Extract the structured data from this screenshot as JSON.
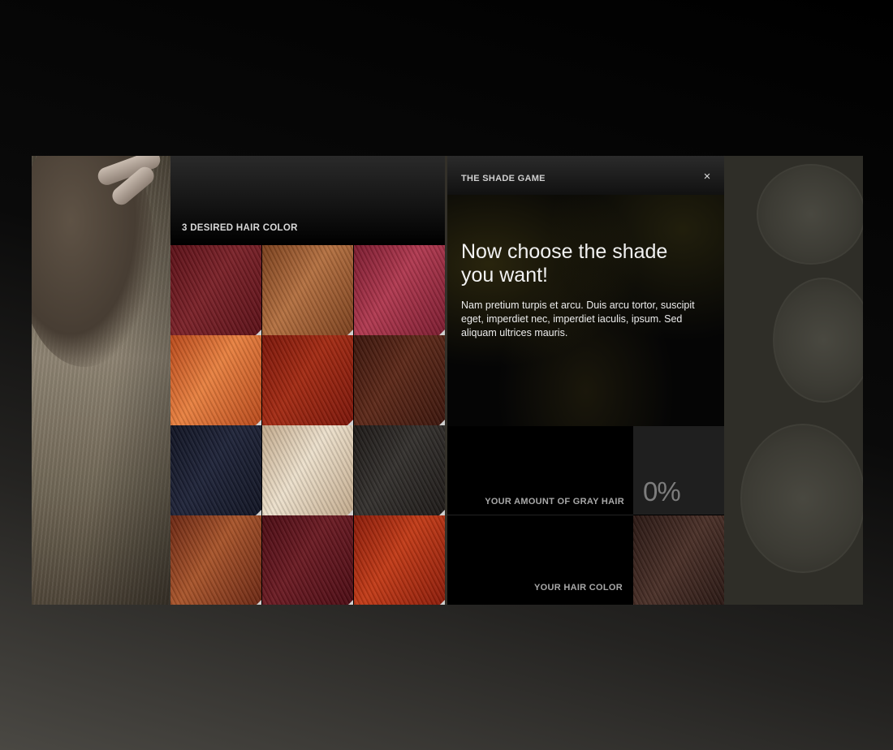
{
  "left_panel": {
    "title": "3 DESIRED HAIR COLOR",
    "swatches": [
      {
        "name": "burgundy",
        "color": "#5a0f16",
        "highlight": "#7a2128"
      },
      {
        "name": "copper-brown",
        "color": "#7a3f1c",
        "highlight": "#b47040"
      },
      {
        "name": "raspberry",
        "color": "#7a1a2e",
        "highlight": "#b0384f"
      },
      {
        "name": "bright-copper",
        "color": "#b8481a",
        "highlight": "#e8803f"
      },
      {
        "name": "red",
        "color": "#7a1408",
        "highlight": "#a32a12"
      },
      {
        "name": "dark-auburn",
        "color": "#3a140b",
        "highlight": "#5c2818"
      },
      {
        "name": "blue-black",
        "color": "#101322",
        "highlight": "#1e2338"
      },
      {
        "name": "light-blonde",
        "color": "#c2a98b",
        "highlight": "#ece0cc"
      },
      {
        "name": "soft-black",
        "color": "#1c1816",
        "highlight": "#33302d"
      },
      {
        "name": "auburn",
        "color": "#6a2612",
        "highlight": "#a8542a"
      },
      {
        "name": "deep-burgundy",
        "color": "#4a0a12",
        "highlight": "#6a1a22"
      },
      {
        "name": "vivid-red",
        "color": "#8a1a08",
        "highlight": "#c23a16"
      }
    ]
  },
  "right_panel": {
    "title": "THE SHADE GAME",
    "close_icon": "close-icon",
    "close_glyph": "×",
    "headline": "Now choose the shade you want!",
    "body": "Nam pretium turpis et arcu. Duis arcu tortor, suscipit eget, imperdiet nec, imperdiet iaculis, ipsum. Sed aliquam ultrices mauris.",
    "gray_label": "YOUR AMOUNT OF GRAY HAIR",
    "gray_value": "0%",
    "hair_label": "YOUR HAIR COLOR",
    "hair_color": {
      "color": "#2a1814",
      "highlight": "#4a3028"
    }
  }
}
